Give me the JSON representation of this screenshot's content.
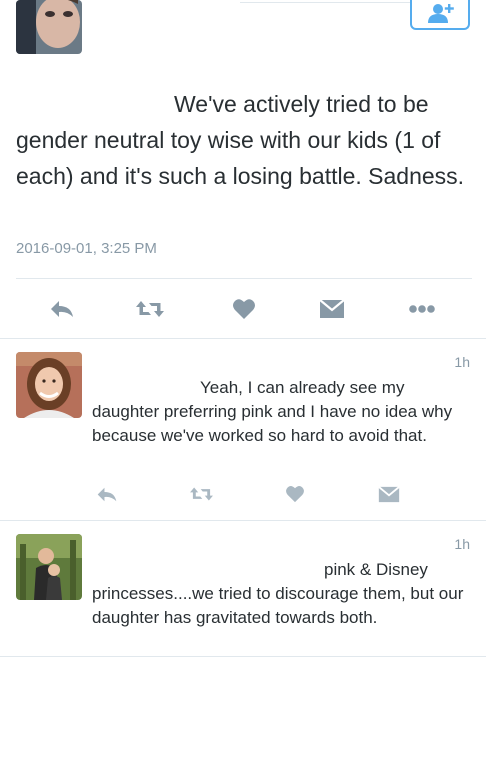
{
  "main_tweet": {
    "text_line1": "We've actively tried to be",
    "text_rest": "gender neutral toy wise with our kids (1 of each) and it's such a losing battle. Sadness.",
    "timestamp": "2016-09-01, 3:25 PM"
  },
  "actions": {
    "icons": [
      "reply-icon",
      "retweet-icon",
      "like-icon",
      "message-icon",
      "more-icon"
    ]
  },
  "replies": [
    {
      "time": "1h",
      "text_line1": "Yeah, I can already see my",
      "text_rest": "daughter preferring pink and I have no idea why because we've worked so hard to avoid that."
    },
    {
      "time": "1h",
      "text_line1": "pink & Disney",
      "text_rest": "princesses....we tried to discourage them, but our daughter has gravitated towards both."
    }
  ],
  "colors": {
    "accent": "#55acee",
    "icon_gray": "#8899a6",
    "text": "#292f33",
    "divider": "#e1e8ed"
  }
}
